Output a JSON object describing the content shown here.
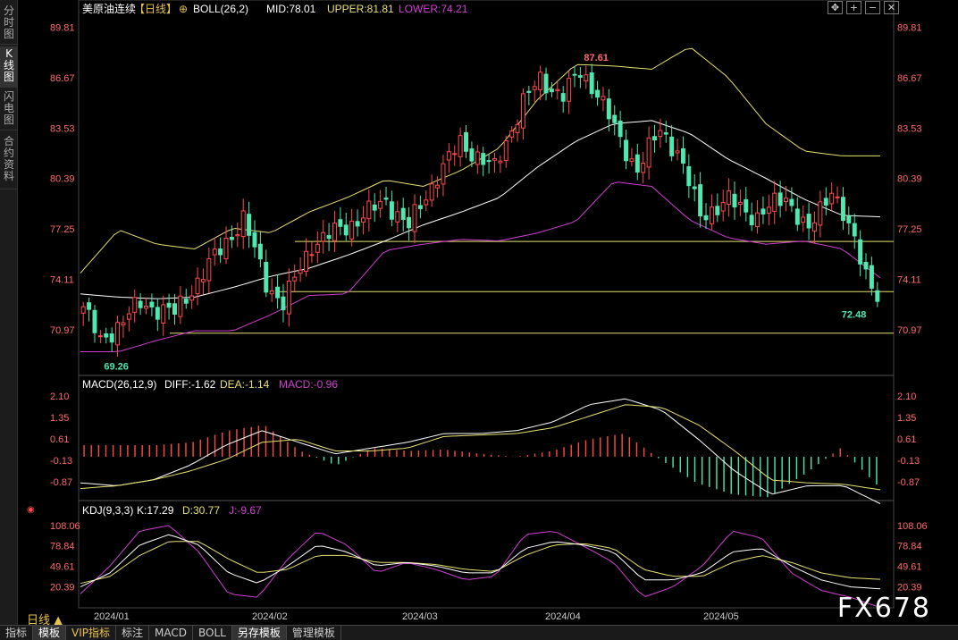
{
  "sidebar": {
    "tabs": [
      {
        "label": "分时图",
        "active": false
      },
      {
        "label": "K线图",
        "active": true
      },
      {
        "label": "闪电图",
        "active": false
      },
      {
        "label": "合约资料",
        "active": false
      }
    ]
  },
  "header": {
    "title": "美原油连续",
    "period": "【日线】",
    "boll": "BOLL(26,2)",
    "mid": "MID:78.01",
    "upper": "UPPER:81.81",
    "lower": "LOWER:74.21"
  },
  "toolbar": {
    "icons": [
      "move-icon",
      "zoom-in-icon",
      "zoom-out-icon",
      "close-icon"
    ]
  },
  "macd_header": {
    "name": "MACD(26,12,9)",
    "diff": "DIFF:-1.62",
    "dea": "DEA:-1.14",
    "macd": "MACD:-0.96"
  },
  "kdj_header": {
    "name": "KDJ(9,3,3)",
    "k": "K:17.29",
    "d": "D:30.77",
    "j": "J:-9.67"
  },
  "footer": {
    "period_label": "日线 ▲",
    "tabs": [
      "指标",
      "模板",
      "VIP指标",
      "标注",
      "MACD",
      "BOLL",
      "另存模板",
      "管理模板"
    ],
    "active_tabs": [
      "模板",
      "另存模板"
    ],
    "watermark": "FX678"
  },
  "colors": {
    "up": "#ff4a4a",
    "down": "#4ee8b0",
    "mid": "#ffffff",
    "upper": "#e8e070",
    "lower": "#d040d0",
    "dea": "#e8e070",
    "kdj_j": "#d040d0"
  },
  "chart_data": [
    {
      "type": "candlestick",
      "title": "美原油连续",
      "yticks": [
        "89.81",
        "86.67",
        "83.53",
        "80.39",
        "77.25",
        "74.11",
        "70.97"
      ],
      "ylim": [
        68.4,
        90.4
      ],
      "xticks": [
        "2024/01",
        "2024/02",
        "2024/03",
        "2024/04",
        "2024/05"
      ],
      "annotations": [
        {
          "text": "87.61",
          "value": 87.61,
          "type": "high"
        },
        {
          "text": "69.26",
          "value": 69.26,
          "type": "low"
        },
        {
          "text": "72.48",
          "value": 72.48,
          "type": "last-low"
        }
      ],
      "hlines": [
        76.47,
        73.34,
        70.75
      ],
      "anchors": [
        {
          "i": 0,
          "c": 72.4
        },
        {
          "i": 3,
          "c": 70.2
        },
        {
          "i": 10,
          "c": 72.6
        },
        {
          "i": 16,
          "c": 72.0
        },
        {
          "i": 22,
          "c": 75.0
        },
        {
          "i": 28,
          "c": 77.9
        },
        {
          "i": 32,
          "c": 73.9
        },
        {
          "i": 35,
          "c": 72.6
        },
        {
          "i": 40,
          "c": 76.3
        },
        {
          "i": 47,
          "c": 77.6
        },
        {
          "i": 53,
          "c": 79.0
        },
        {
          "i": 57,
          "c": 77.4
        },
        {
          "i": 62,
          "c": 80.6
        },
        {
          "i": 66,
          "c": 82.6
        },
        {
          "i": 72,
          "c": 81.0
        },
        {
          "i": 77,
          "c": 85.2
        },
        {
          "i": 80,
          "c": 86.5
        },
        {
          "i": 84,
          "c": 85.6
        },
        {
          "i": 87,
          "c": 87.0
        },
        {
          "i": 90,
          "c": 85.8
        },
        {
          "i": 94,
          "c": 82.7
        },
        {
          "i": 97,
          "c": 81.0
        },
        {
          "i": 101,
          "c": 83.4
        },
        {
          "i": 104,
          "c": 82.1
        },
        {
          "i": 108,
          "c": 78.1
        },
        {
          "i": 113,
          "c": 79.0
        },
        {
          "i": 118,
          "c": 78.0
        },
        {
          "i": 123,
          "c": 79.3
        },
        {
          "i": 127,
          "c": 77.0
        },
        {
          "i": 131,
          "c": 79.9
        },
        {
          "i": 134,
          "c": 77.2
        },
        {
          "i": 137,
          "c": 74.6
        },
        {
          "i": 139,
          "c": 73.2
        }
      ],
      "candle_count": 140,
      "boll": {
        "mid": [
          73.2,
          73.0,
          72.9,
          73.0,
          73.6,
          74.3,
          74.8,
          75.6,
          76.5,
          77.5,
          78.3,
          79.2,
          81.1,
          82.7,
          83.8,
          84.0,
          83.2,
          81.6,
          80.4,
          79.1,
          78.1,
          78.0
        ],
        "upper": [
          74.5,
          77.2,
          76.3,
          76.0,
          77.3,
          77.0,
          78.3,
          79.2,
          80.3,
          79.9,
          80.9,
          82.3,
          85.3,
          87.5,
          87.4,
          87.2,
          88.6,
          86.7,
          83.8,
          82.1,
          81.8,
          81.8
        ],
        "lower": [
          69.6,
          69.6,
          70.3,
          70.9,
          70.9,
          71.9,
          73.1,
          73.2,
          75.9,
          76.3,
          76.6,
          76.5,
          77.0,
          77.7,
          80.2,
          79.9,
          77.8,
          76.7,
          76.3,
          76.5,
          76.0,
          74.2
        ]
      }
    },
    {
      "type": "macd",
      "yticks": [
        "2.10",
        "1.35",
        "0.61",
        "-0.13",
        "-0.87"
      ],
      "ylim": [
        -1.45,
        2.25
      ],
      "diff": [
        -0.9,
        -1.0,
        -0.8,
        -0.3,
        0.4,
        0.9,
        0.5,
        0.1,
        0.3,
        0.5,
        0.8,
        0.8,
        0.9,
        1.2,
        1.8,
        2.0,
        1.6,
        0.6,
        -0.5,
        -1.3,
        -1.0,
        -1.0,
        -1.62
      ],
      "dea": [
        -1.1,
        -1.0,
        -0.8,
        -0.5,
        -0.1,
        0.5,
        0.6,
        0.2,
        0.2,
        0.3,
        0.7,
        0.75,
        0.8,
        1.0,
        1.4,
        1.8,
        1.7,
        1.1,
        0.2,
        -0.8,
        -0.9,
        -0.95,
        -1.14
      ],
      "hist": [
        0.4,
        0.4,
        0.4,
        0.5,
        0.9,
        1.1,
        0.2,
        -0.3,
        0.3,
        0.2,
        0.25,
        0.1,
        0.0,
        0.2,
        0.6,
        0.8,
        -0.1,
        -0.9,
        -1.3,
        -1.4,
        -0.6,
        0.3,
        -0.96
      ]
    },
    {
      "type": "kdj",
      "yticks": [
        "108.06",
        "78.84",
        "49.61",
        "20.39"
      ],
      "ylim": [
        -10,
        118
      ],
      "k": [
        20,
        40,
        80,
        95,
        80,
        40,
        25,
        50,
        80,
        70,
        50,
        55,
        50,
        40,
        40,
        75,
        85,
        80,
        70,
        30,
        30,
        40,
        70,
        75,
        50,
        30,
        20,
        17.29
      ],
      "d": [
        25,
        35,
        65,
        85,
        85,
        60,
        40,
        45,
        65,
        65,
        55,
        55,
        52,
        45,
        42,
        65,
        80,
        82,
        75,
        45,
        35,
        35,
        55,
        65,
        55,
        40,
        33,
        30.77
      ],
      "j": [
        10,
        50,
        100,
        108,
        70,
        10,
        5,
        60,
        100,
        80,
        40,
        55,
        45,
        30,
        35,
        95,
        100,
        78,
        55,
        5,
        20,
        50,
        100,
        90,
        40,
        15,
        5,
        -9.67
      ]
    }
  ]
}
